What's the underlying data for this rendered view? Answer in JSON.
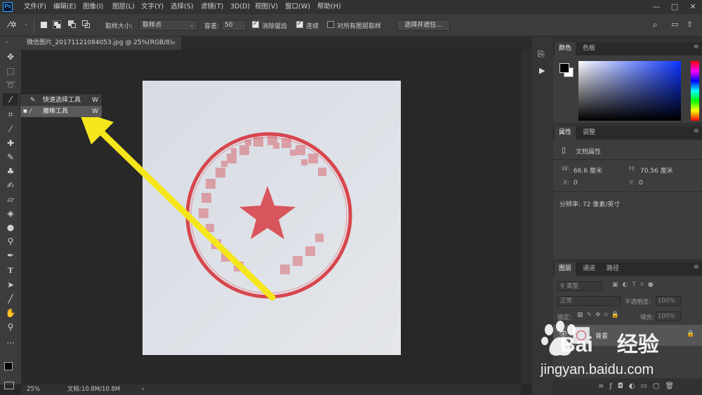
{
  "app": {
    "logo": "Ps"
  },
  "menubar": {
    "items": [
      "文件(F)",
      "编辑(E)",
      "图像(I)",
      "图层(L)",
      "文字(Y)",
      "选择(S)",
      "滤镜(T)",
      "3D(D)",
      "视图(V)",
      "窗口(W)",
      "帮助(H)"
    ],
    "min": "—",
    "max": "□",
    "close": "✕"
  },
  "options": {
    "sample_size_label": "取样大小:",
    "sample_size_value": "取样点",
    "tolerance_label": "容差:",
    "tolerance_value": "50",
    "antialias_label": "消除锯齿",
    "contiguous_label": "连续",
    "all_layers_label": "对所有图层取样",
    "select_mask_label": "选择并遮住..."
  },
  "document": {
    "tab_title": "微信图片_20171121084053.jpg @ 25%(RGB/8)",
    "tab_close": "✕"
  },
  "flyout": {
    "items": [
      {
        "label": "快速选择工具",
        "key": "W"
      },
      {
        "label": "魔棒工具",
        "key": "W"
      }
    ]
  },
  "status": {
    "zoom": "25%",
    "doc_size": "文档:10.8M/10.8M",
    "arrow": "›"
  },
  "panels": {
    "color": {
      "tabs": [
        "颜色",
        "色板"
      ]
    },
    "properties": {
      "tabs": [
        "属性",
        "调整"
      ],
      "doc_props": "文档属性",
      "w_label": "W:",
      "w_value": "66.6 厘米",
      "h_label": "H:",
      "h_value": "70.56 厘米",
      "x_label": "X:",
      "x_value": "0",
      "y_label": "Y:",
      "y_value": "0",
      "resolution": "分辨率: 72 像素/英寸"
    },
    "layers": {
      "tabs": [
        "图层",
        "通道",
        "路径"
      ],
      "kind_label": "类型",
      "blend_mode": "正常",
      "opacity_label": "不透明度:",
      "opacity_value": "100%",
      "lock_label": "锁定:",
      "fill_label": "填充:",
      "fill_value": "100%",
      "layer_name": "背景"
    }
  },
  "watermark": {
    "brand": "Bai",
    "brand2": "经验",
    "url": "jingyan.baidu.com"
  },
  "colors": {
    "arrow": "#f5e61c",
    "stamp": "#d8464e",
    "accent": "#31a8ff"
  }
}
